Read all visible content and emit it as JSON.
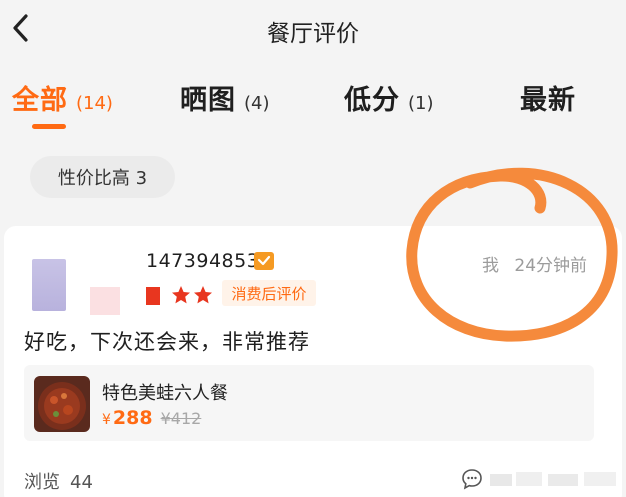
{
  "header": {
    "back_icon": "chevron-left-icon",
    "title": "餐厅评价"
  },
  "tabs": [
    {
      "label": "全部",
      "count": "(14)",
      "active": true
    },
    {
      "label": "晒图",
      "count": "(4)",
      "active": false
    },
    {
      "label": "低分",
      "count": "(1)",
      "active": false
    },
    {
      "label": "最新",
      "count": "",
      "active": false
    }
  ],
  "filter_chip": {
    "label": "性价比高 3"
  },
  "review": {
    "user_id": "147394853",
    "verified_icon": "check-badge-icon",
    "rating_icon": "star-icon",
    "consumed_badge": "消费后评价",
    "author_tag": "我",
    "time": "24分钟前",
    "comment": "好吃，下次还会来，非常推荐",
    "product": {
      "name": "特色美蛙六人餐",
      "currency": "¥",
      "price": "288",
      "original_price": "¥412"
    },
    "views_label": "浏览",
    "views_count": "44",
    "comment_icon": "comment-bubble-icon"
  },
  "colors": {
    "accent": "#ff6a13",
    "annotation": "#f58a3c",
    "muted": "#9c9c9c"
  }
}
